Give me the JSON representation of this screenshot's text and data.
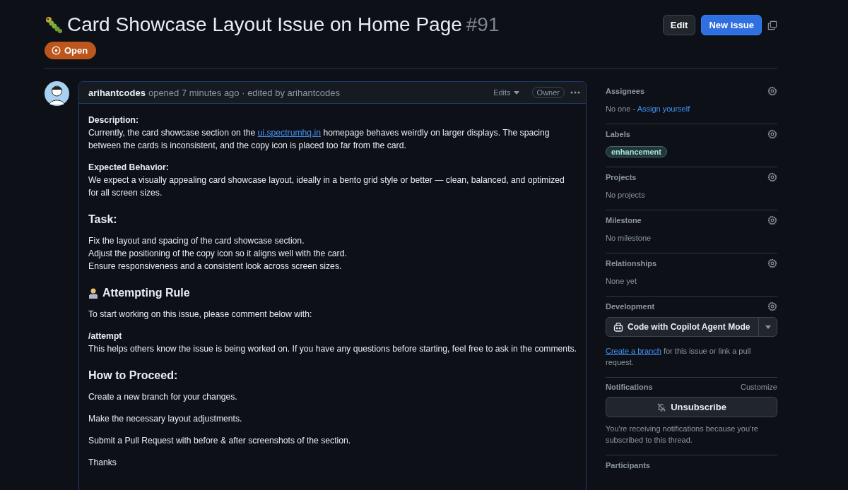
{
  "issue": {
    "title": "Card Showcase Layout Issue on Home Page",
    "number": "#91",
    "status": "Open",
    "actions": [
      {
        "kind": "secondary",
        "label": "Edit"
      },
      {
        "kind": "primary",
        "label": "New issue"
      }
    ]
  },
  "comment": {
    "author": "arihantcodes",
    "meta": "opened 7 minutes ago · edited by arihantcodes",
    "edits": "Edits",
    "role": "Owner",
    "body": [
      {
        "kind": "paragraph",
        "lead": "Description:",
        "segments": [
          {
            "text": "Currently, the card showcase section on the "
          },
          {
            "text": "ui.spectrumhq.in",
            "link": true
          },
          {
            "text": " homepage behaves weirdly on larger displays. The spacing between the cards is inconsistent, and the copy icon is placed too far from the card."
          }
        ]
      },
      {
        "kind": "paragraph",
        "lead": "Expected Behavior:",
        "segments": [
          {
            "text": "We expect a visually appealing card showcase layout, ideally in a bento grid style or better — clean, balanced, and optimized for all screen sizes."
          }
        ]
      },
      {
        "kind": "heading",
        "text": "Task:"
      },
      {
        "kind": "lines",
        "lines": [
          "Fix the layout and spacing of the card showcase section.",
          "Adjust the positioning of the copy icon so it aligns well with the card.",
          "Ensure responsiveness and a consistent look across screen sizes."
        ]
      },
      {
        "kind": "heading",
        "text": "Attempting Rule",
        "icon": true
      },
      {
        "kind": "paragraph",
        "segments": [
          {
            "text": "To start working on this issue, please comment below with:"
          }
        ]
      },
      {
        "kind": "paragraph",
        "lead": "/attempt",
        "segments": [
          {
            "text": "This helps others know the issue is being worked on. If you have any questions before starting, feel free to ask in the comments."
          }
        ]
      },
      {
        "kind": "heading",
        "text": "How to Proceed:"
      },
      {
        "kind": "paragraph",
        "segments": [
          {
            "text": "Create a new branch for your changes."
          }
        ]
      },
      {
        "kind": "paragraph",
        "segments": [
          {
            "text": "Make the necessary layout adjustments."
          }
        ]
      },
      {
        "kind": "paragraph",
        "segments": [
          {
            "text": "Submit a Pull Request with before & after screenshots of the section."
          }
        ]
      },
      {
        "kind": "paragraph",
        "segments": [
          {
            "text": "Thanks"
          }
        ]
      }
    ]
  },
  "sidebar": [
    {
      "kind": "assign",
      "title": "Assignees",
      "text": "No one - ",
      "link": "Assign yourself"
    },
    {
      "kind": "labels",
      "title": "Labels",
      "labels": [
        "enhancement"
      ]
    },
    {
      "kind": "text",
      "title": "Projects",
      "text": "No projects"
    },
    {
      "kind": "text",
      "title": "Milestone",
      "text": "No milestone"
    },
    {
      "kind": "text",
      "title": "Relationships",
      "text": "None yet"
    },
    {
      "kind": "development",
      "title": "Development",
      "button": "Code with Copilot Agent Mode",
      "link": "Create a branch",
      "text": " for this issue or link a pull request."
    },
    {
      "kind": "notifications",
      "title": "Notifications",
      "action": "Customize",
      "button": "Unsubscribe",
      "text": "You're receiving notifications because you're subscribed to this thread."
    },
    {
      "kind": "partial",
      "title": "Participants"
    }
  ]
}
